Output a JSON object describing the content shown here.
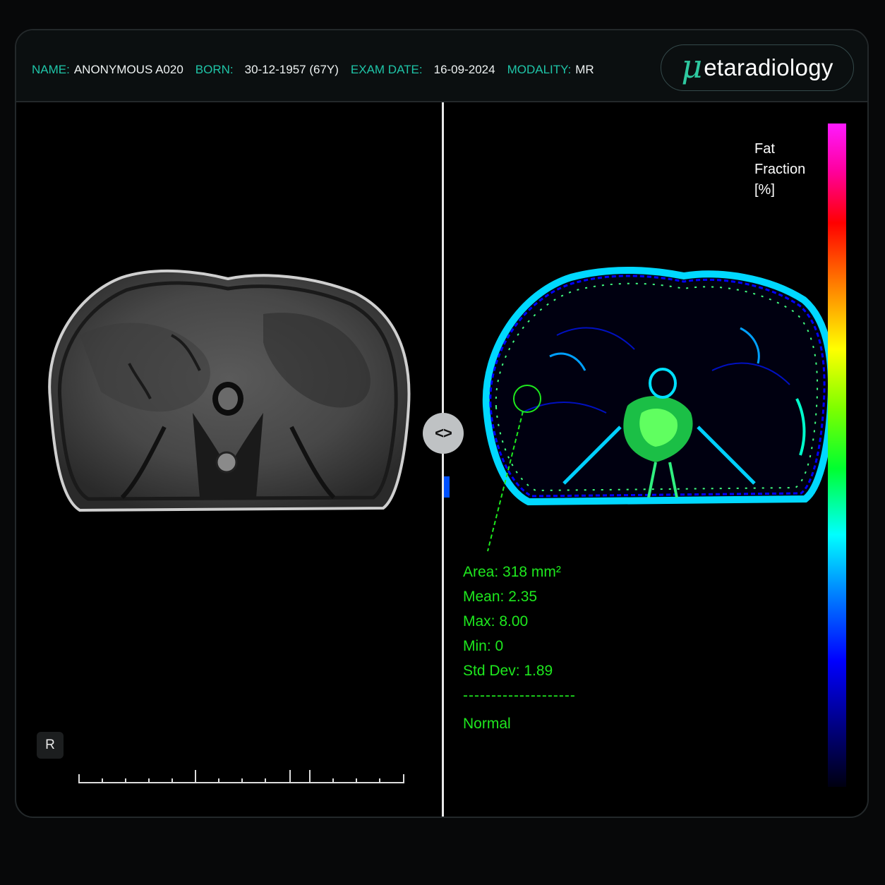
{
  "patient": {
    "name_label": "NAME:",
    "name": "ANONYMOUS A020",
    "born_label": "BORN:",
    "born": "30-12-1957 (67Y)",
    "exam_date_label": "EXAM DATE:",
    "exam_date": "16-09-2024",
    "modality_label": "MODALITY:",
    "modality": "MR"
  },
  "brand": {
    "mu": "μ",
    "name": "etaradiology"
  },
  "viewer": {
    "orientation_marker": "R",
    "compare_handle": "<>",
    "legend": {
      "line1": "Fat",
      "line2": "Fraction",
      "line3": "[%]"
    },
    "roi_stats": {
      "area": "Area: 318 mm²",
      "mean": "Mean: 2.35",
      "max": "Max: 8.00",
      "min": "Min: 0",
      "std": "Std Dev: 1.89",
      "separator": "--------------------",
      "classification": "Normal"
    }
  },
  "colors": {
    "accent_label": "#1fc5a8",
    "roi_green": "#1ee81e",
    "brand_mu": "#2ec9a0"
  }
}
